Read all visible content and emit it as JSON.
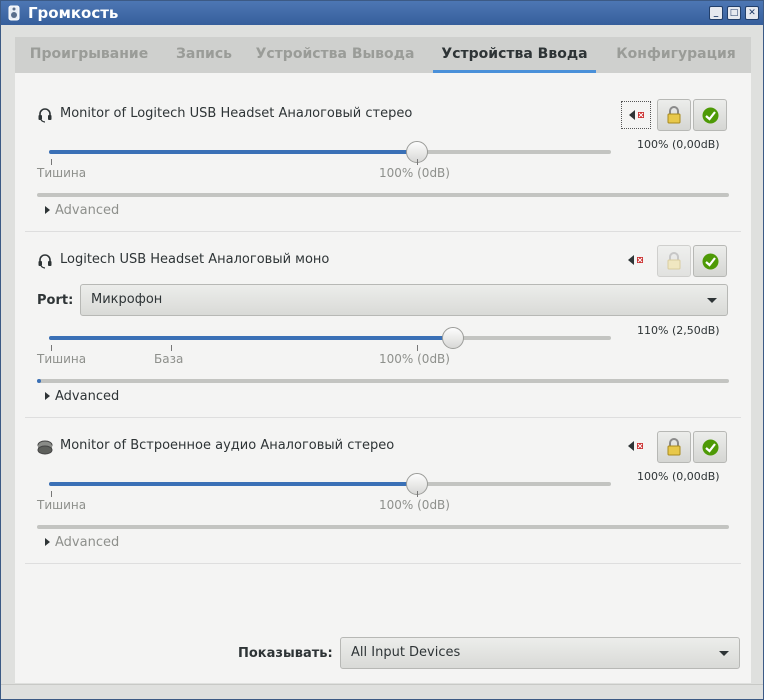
{
  "window": {
    "title": "Громкость"
  },
  "tabs": [
    {
      "label": "Проигрывание",
      "active": false
    },
    {
      "label": "Запись",
      "active": false
    },
    {
      "label": "Устройства Вывода",
      "active": false
    },
    {
      "label": "Устройства Ввода",
      "active": true
    },
    {
      "label": "Конфигурация",
      "active": false
    }
  ],
  "devices": [
    {
      "name": "Monitor of Logitech USB Headset Аналоговый стерео",
      "icon": "headset-icon",
      "volume_text": "100% (0,00dB)",
      "volume_percent": 100,
      "meter_level": 0,
      "ticks": {
        "silence": "Тишина",
        "norm": "100% (0dB)"
      },
      "advanced": "Advanced"
    },
    {
      "name": "Logitech USB Headset Аналоговый моно",
      "icon": "headset-icon",
      "port_label": "Port:",
      "port_value": "Микрофон",
      "volume_text": "110% (2,50dB)",
      "volume_percent": 110,
      "meter_level": 0.01,
      "ticks": {
        "silence": "Тишина",
        "base": "База",
        "norm": "100% (0dB)"
      },
      "advanced": "Advanced"
    },
    {
      "name": "Monitor of Встроенное аудио Аналоговый стерео",
      "icon": "sound-card-icon",
      "volume_text": "100% (0,00dB)",
      "volume_percent": 100,
      "meter_level": 0,
      "ticks": {
        "silence": "Тишина",
        "norm": "100% (0dB)"
      },
      "advanced": "Advanced"
    }
  ],
  "footer": {
    "show_label": "Показывать:",
    "show_value": "All Input Devices"
  },
  "colors": {
    "accent": "#3a70b6",
    "titlebar": "#4d77b4",
    "lock": "#e8c84a",
    "check": "#4e9a06"
  }
}
